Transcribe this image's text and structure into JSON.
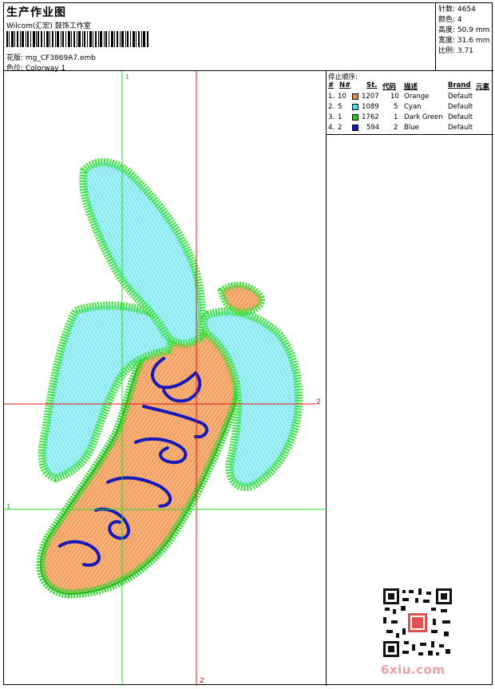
{
  "header": {
    "title": "生产作业图",
    "studio": "Wilcom(汇宏) 鼓饰工作室",
    "design_file": "花版: mg_CF3869A7.emb",
    "colorway": "色位: Colorway 1"
  },
  "stats": [
    {
      "label": "针数",
      "value": "4654"
    },
    {
      "label": "颜色",
      "value": "4"
    },
    {
      "label": "高度",
      "value": "50.9 mm"
    },
    {
      "label": "宽度",
      "value": "31.6 mm"
    },
    {
      "label": "比例",
      "value": "3.71"
    }
  ],
  "stop_sequence": {
    "title": "停止顺序:",
    "columns": [
      "#",
      "N#",
      "St.",
      "代码",
      "描述",
      "Brand",
      "元素"
    ],
    "rows": [
      {
        "num": "1.",
        "n": "10",
        "color": "#f0883a",
        "st": "1207",
        "code": "10",
        "desc": "Orange",
        "brand": "Default"
      },
      {
        "num": "2.",
        "n": "5",
        "color": "#3fe0e8",
        "st": "1089",
        "code": "5",
        "desc": "Cyan",
        "brand": "Default"
      },
      {
        "num": "3.",
        "n": "1",
        "color": "#22cc22",
        "st": "1762",
        "code": "1",
        "desc": "Dark Green",
        "brand": "Default"
      },
      {
        "num": "4.",
        "n": "2",
        "color": "#1515c8",
        "st": "594",
        "code": "2",
        "desc": "Blue",
        "brand": "Default"
      }
    ]
  },
  "axis_labels": {
    "top": "1",
    "bottom": "2",
    "right": "2",
    "left": "1"
  },
  "watermark": "6xiu.com",
  "colors": {
    "green_line": "#22dd22",
    "red_line": "#ee1111",
    "orange": "#f0a060",
    "cyan": "#7ee6f0",
    "green": "#33dd33",
    "blue": "#1818b8"
  }
}
